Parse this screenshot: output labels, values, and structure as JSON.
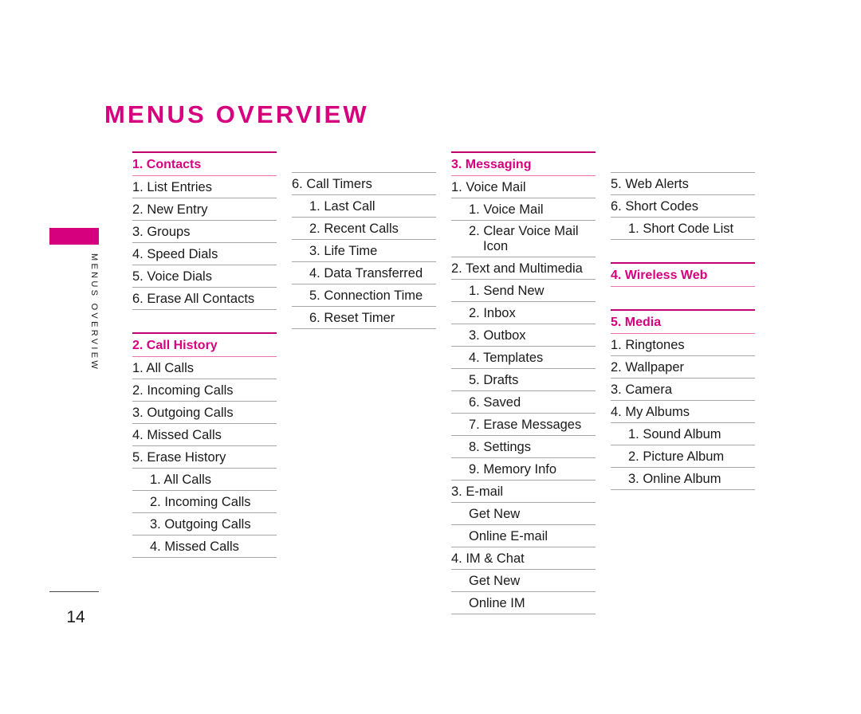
{
  "page": {
    "title": "MENUS OVERVIEW",
    "number": "14",
    "sidebar_label": "MENUS OVERVIEW",
    "accent_color": "#d6007f",
    "rule_color": "#a6a6a6"
  },
  "columns": [
    {
      "id": "column-1",
      "offset": false,
      "rows": [
        {
          "kind": "section",
          "label": "1. Contacts"
        },
        {
          "kind": "item",
          "label": "1. List Entries"
        },
        {
          "kind": "item",
          "label": "2. New Entry"
        },
        {
          "kind": "item",
          "label": "3. Groups"
        },
        {
          "kind": "item",
          "label": "4. Speed Dials"
        },
        {
          "kind": "item",
          "label": "5. Voice Dials"
        },
        {
          "kind": "item",
          "label": "6. Erase All Contacts"
        },
        {
          "kind": "section",
          "label": "2. Call History",
          "gap_above": true
        },
        {
          "kind": "item",
          "label": "1. All Calls"
        },
        {
          "kind": "item",
          "label": "2. Incoming Calls"
        },
        {
          "kind": "item",
          "label": "3. Outgoing Calls"
        },
        {
          "kind": "item",
          "label": "4. Missed Calls"
        },
        {
          "kind": "item",
          "label": "5. Erase History"
        },
        {
          "kind": "sub",
          "label": "1. All Calls"
        },
        {
          "kind": "sub",
          "label": "2. Incoming Calls"
        },
        {
          "kind": "sub",
          "label": "3. Outgoing Calls"
        },
        {
          "kind": "sub",
          "label": "4. Missed Calls"
        }
      ]
    },
    {
      "id": "column-2",
      "offset": true,
      "rows": [
        {
          "kind": "item",
          "label": "6. Call Timers",
          "top_rule": true
        },
        {
          "kind": "sub",
          "label": "1. Last Call"
        },
        {
          "kind": "sub",
          "label": "2. Recent Calls"
        },
        {
          "kind": "sub",
          "label": "3. Life Time"
        },
        {
          "kind": "sub",
          "label": "4. Data Transferred"
        },
        {
          "kind": "sub",
          "label": "5. Connection Time"
        },
        {
          "kind": "sub",
          "label": "6. Reset Timer"
        }
      ]
    },
    {
      "id": "column-3",
      "offset": false,
      "rows": [
        {
          "kind": "section",
          "label": "3. Messaging"
        },
        {
          "kind": "item",
          "label": "1. Voice Mail"
        },
        {
          "kind": "sub",
          "label": "1. Voice Mail"
        },
        {
          "kind": "wrap",
          "label": "2. Clear Voice Mail",
          "label2": "Icon"
        },
        {
          "kind": "item",
          "label": "2. Text and Multimedia"
        },
        {
          "kind": "sub",
          "label": "1. Send New"
        },
        {
          "kind": "sub",
          "label": "2. Inbox"
        },
        {
          "kind": "sub",
          "label": "3. Outbox"
        },
        {
          "kind": "sub",
          "label": "4. Templates"
        },
        {
          "kind": "sub",
          "label": "5. Drafts"
        },
        {
          "kind": "sub",
          "label": "6. Saved"
        },
        {
          "kind": "sub",
          "label": "7. Erase Messages"
        },
        {
          "kind": "sub",
          "label": "8. Settings"
        },
        {
          "kind": "sub",
          "label": "9. Memory Info"
        },
        {
          "kind": "item",
          "label": "3. E-mail"
        },
        {
          "kind": "sub",
          "label": "Get New"
        },
        {
          "kind": "sub",
          "label": "Online E-mail"
        },
        {
          "kind": "item",
          "label": "4. IM & Chat"
        },
        {
          "kind": "sub",
          "label": "Get New"
        },
        {
          "kind": "sub",
          "label": "Online IM"
        }
      ]
    },
    {
      "id": "column-4",
      "offset": true,
      "rows": [
        {
          "kind": "item",
          "label": "5. Web Alerts",
          "top_rule": true
        },
        {
          "kind": "item",
          "label": "6. Short Codes"
        },
        {
          "kind": "sub",
          "label": "1. Short Code List"
        },
        {
          "kind": "section",
          "label": "4. Wireless Web",
          "gap_above": true
        },
        {
          "kind": "section",
          "label": "5. Media",
          "gap_above": true
        },
        {
          "kind": "item",
          "label": "1. Ringtones"
        },
        {
          "kind": "item",
          "label": "2. Wallpaper"
        },
        {
          "kind": "item",
          "label": "3. Camera"
        },
        {
          "kind": "item",
          "label": "4. My Albums"
        },
        {
          "kind": "sub",
          "label": "1. Sound Album"
        },
        {
          "kind": "sub",
          "label": "2. Picture Album"
        },
        {
          "kind": "sub",
          "label": "3. Online Album"
        }
      ]
    }
  ]
}
